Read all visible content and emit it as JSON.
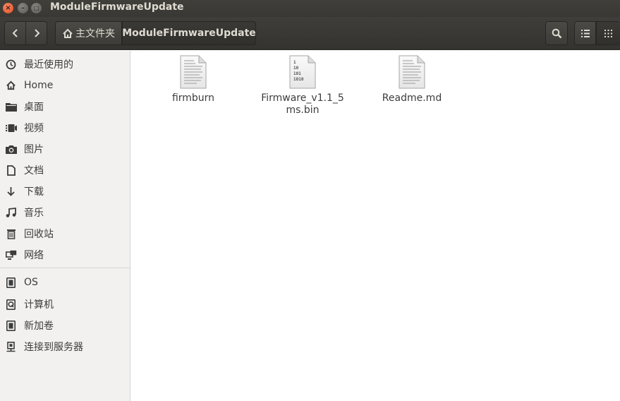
{
  "window": {
    "title": "ModuleFirmwareUpdate",
    "close_glyph": "×",
    "minimize_glyph": "–",
    "maximize_glyph": "□"
  },
  "toolbar": {
    "back_icon": "chevron-left-icon",
    "forward_icon": "chevron-right-icon",
    "breadcrumb": [
      {
        "label": "主文件夹",
        "icon": "home-icon"
      },
      {
        "label": "ModuleFirmwareUpdate"
      }
    ],
    "search_icon": "search-icon",
    "view_list_icon": "list-view-icon",
    "view_grid_icon": "grid-view-icon"
  },
  "sidebar": {
    "places": [
      {
        "label": "最近使用的",
        "icon": "recent-icon"
      },
      {
        "label": "Home",
        "icon": "home-icon"
      },
      {
        "label": "桌面",
        "icon": "folder-icon"
      },
      {
        "label": "视频",
        "icon": "video-icon"
      },
      {
        "label": "图片",
        "icon": "camera-icon"
      },
      {
        "label": "文档",
        "icon": "document-icon"
      },
      {
        "label": "下载",
        "icon": "download-icon"
      },
      {
        "label": "音乐",
        "icon": "music-icon"
      },
      {
        "label": "回收站",
        "icon": "trash-icon"
      },
      {
        "label": "网络",
        "icon": "network-icon"
      }
    ],
    "devices": [
      {
        "label": "OS",
        "icon": "drive-icon"
      },
      {
        "label": "计算机",
        "icon": "computer-icon"
      },
      {
        "label": "新加卷",
        "icon": "drive-icon"
      },
      {
        "label": "连接到服务器",
        "icon": "server-icon"
      }
    ]
  },
  "files": [
    {
      "name": "firmburn",
      "icon": "text-file-icon"
    },
    {
      "name": "Firmware_v1.1_5ms.bin",
      "icon": "binary-file-icon",
      "icon_text": [
        "1",
        "10",
        "101",
        "1010"
      ]
    },
    {
      "name": "Readme.md",
      "icon": "text-file-icon"
    }
  ]
}
